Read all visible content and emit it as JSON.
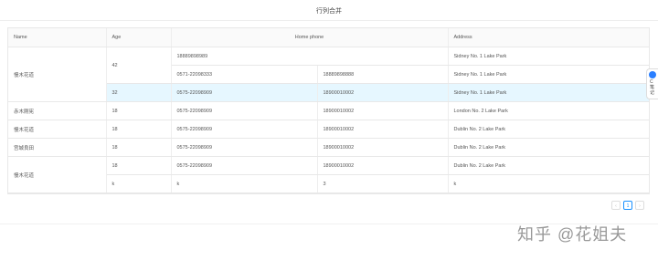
{
  "page": {
    "title": "行列合并"
  },
  "table": {
    "headers": {
      "name": "Name",
      "age": "Age",
      "phone": "Home phone",
      "address": "Address"
    },
    "rows": [
      {
        "name": "慢木花道",
        "age": "42",
        "phone1": "18889898989",
        "phone2": "",
        "address": "Sidney No. 1 Lake Park"
      },
      {
        "phone1": "0571-22098333",
        "phone2": "18889898888",
        "address": "Sidney No. 1 Lake Park"
      },
      {
        "age": "32",
        "phone1": "0575-22098909",
        "phone2": "18900010002",
        "address": "Sidney No. 1 Lake Park"
      },
      {
        "name": "赤木刚宪",
        "age": "18",
        "phone1": "0575-22098909",
        "phone2": "18900010002",
        "address": "London No. 2 Lake Park"
      },
      {
        "name": "慢木花道",
        "age": "18",
        "phone1": "0575-22098909",
        "phone2": "18900010002",
        "address": "Dublin No. 2 Lake Park"
      },
      {
        "name": "宫城良田",
        "age": "18",
        "phone1": "0575-22098909",
        "phone2": "18900010002",
        "address": "Dublin No. 2 Lake Park"
      },
      {
        "name": "慢木花道",
        "age": "18",
        "phone1": "0575-22098909",
        "phone2": "18900010002",
        "address": "Dublin No. 2 Lake Park"
      },
      {
        "age": "k",
        "phone1": "k",
        "phone2": "3",
        "address": "k"
      }
    ]
  },
  "pagination": {
    "prev": "‹",
    "current": "1",
    "next": "›"
  },
  "watermark": "知乎 @花姐夫",
  "side_widget": {
    "text": "C\n笔\n记"
  }
}
